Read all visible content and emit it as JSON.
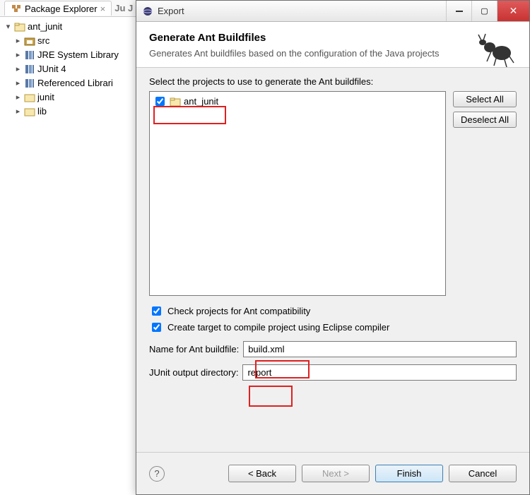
{
  "explorer": {
    "tab_label": "Package Explorer",
    "close_x": "×",
    "other_tab": "Ju J",
    "root": "ant_junit",
    "items": [
      "src",
      "JRE System Library",
      "JUnit 4",
      "Referenced Librari",
      "junit",
      "lib"
    ]
  },
  "dialog": {
    "window_title": "Export",
    "header_title": "Generate Ant Buildfiles",
    "header_desc": "Generates Ant buildfiles based on the configuration of the Java projects",
    "select_label": "Select the projects to use to generate the Ant buildfiles:",
    "projects": [
      {
        "name": "ant_junit",
        "checked": true
      }
    ],
    "btn_select_all": "Select All",
    "btn_deselect_all": "Deselect All",
    "check_compat": {
      "label": "Check projects for Ant compatibility",
      "checked": true
    },
    "check_compile": {
      "label": "Create target to compile project using Eclipse compiler",
      "checked": true
    },
    "name_label": "Name for Ant buildfile:",
    "name_value": "build.xml",
    "junit_label": "JUnit output directory:",
    "junit_value": "report",
    "btn_back": "< Back",
    "btn_next": "Next >",
    "btn_finish": "Finish",
    "btn_cancel": "Cancel",
    "help_q": "?"
  }
}
